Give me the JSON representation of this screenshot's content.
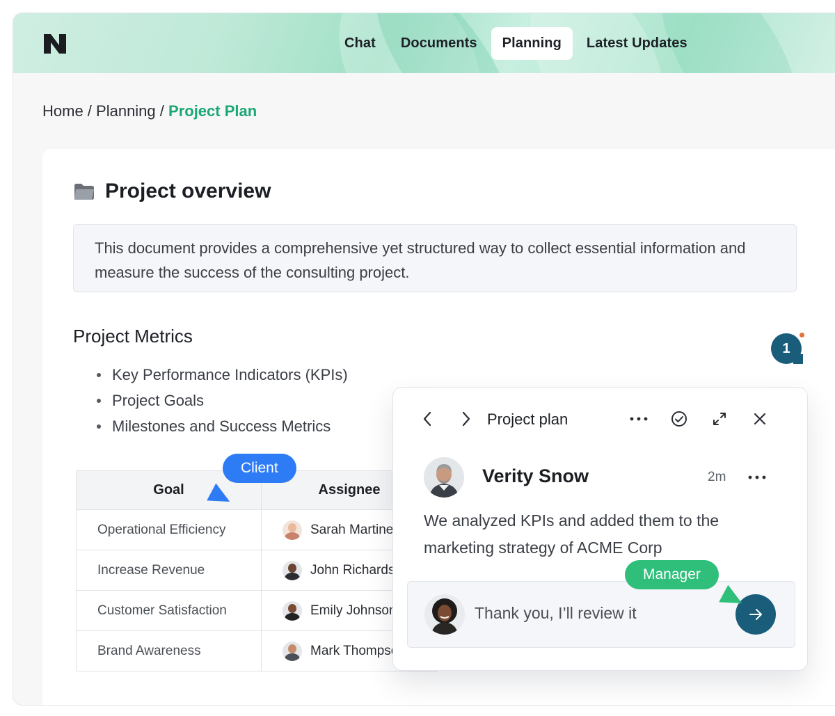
{
  "nav": {
    "items": [
      {
        "label": "Chat",
        "active": false
      },
      {
        "label": "Documents",
        "active": false
      },
      {
        "label": "Planning",
        "active": true
      },
      {
        "label": "Latest Updates",
        "active": false
      }
    ]
  },
  "breadcrumb": {
    "home": "Home",
    "sep1": " / ",
    "section": "Planning",
    "sep2": " / ",
    "current": "Project Plan"
  },
  "doc": {
    "title": "Project overview",
    "note": "This document provides a comprehensive yet structured way to collect essential information and measure the success of the consulting project.",
    "metrics_title": "Project Metrics",
    "metrics": [
      "Key Performance Indicators (KPIs)",
      "Project Goals",
      "Milestones and Success Metrics"
    ]
  },
  "table": {
    "headers": [
      "Goal",
      "Assignee"
    ],
    "rows": [
      {
        "goal": "Operational Efficiency",
        "assignee": "Sarah Martinez"
      },
      {
        "goal": "Increase Revenue",
        "assignee": "John Richards"
      },
      {
        "goal": "Customer Satisfaction",
        "assignee": "Emily Johnson"
      },
      {
        "goal": "Brand Awareness",
        "assignee": "Mark Thompson"
      }
    ]
  },
  "tags": {
    "client": "Client",
    "manager": "Manager"
  },
  "comment_count": "1",
  "panel": {
    "title": "Project plan",
    "author": "Verity Snow",
    "time": "2m",
    "message": "We analyzed KPIs and added them to the marketing strategy of ACME Corp",
    "reply_placeholder": "Thank you, I’ll review it"
  },
  "colors": {
    "accent_green": "#1aa874",
    "client_tag": "#2d7cf6",
    "manager_tag": "#2fbf7b",
    "primary_dark": "#195d7a"
  },
  "icons": [
    "logo-icon",
    "folder-icon",
    "chevron-left-icon",
    "chevron-right-icon",
    "more-icon",
    "check-circle-icon",
    "expand-icon",
    "close-icon",
    "send-arrow-icon"
  ]
}
